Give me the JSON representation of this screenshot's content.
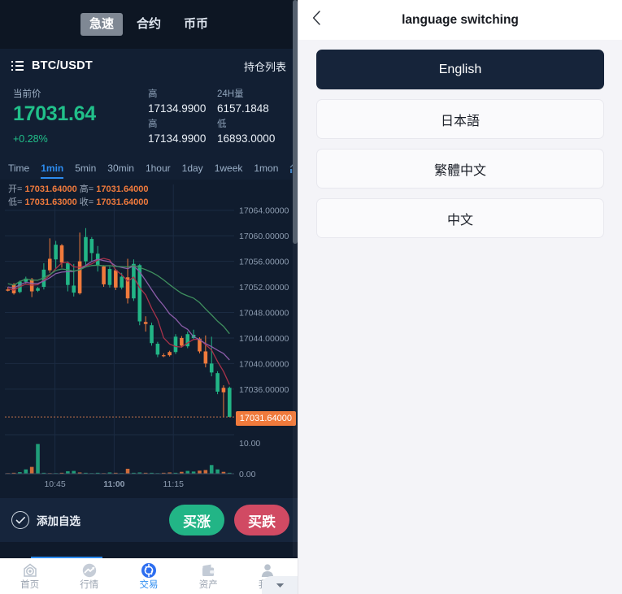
{
  "left": {
    "top_tabs": [
      {
        "label": "急速",
        "active": true
      },
      {
        "label": "合约",
        "active": false
      },
      {
        "label": "币币",
        "active": false
      }
    ],
    "pair": {
      "icon": "list-icon",
      "name": "BTC/USDT",
      "positions_label": "持仓列表"
    },
    "quote": {
      "current_label": "当前价",
      "current_price": "17031.64",
      "change_percent": "+0.28%",
      "cells": [
        {
          "label": "高",
          "value": "17134.9900"
        },
        {
          "label": "24H量",
          "value": "6157.1848"
        },
        {
          "label": "高",
          "value": "17134.9900"
        },
        {
          "label": "低",
          "value": "16893.0000"
        }
      ]
    },
    "intervals": [
      {
        "label": "Time",
        "active": false
      },
      {
        "label": "1min",
        "active": true
      },
      {
        "label": "5min",
        "active": false
      },
      {
        "label": "30min",
        "active": false
      },
      {
        "label": "1hour",
        "active": false
      },
      {
        "label": "1day",
        "active": false
      },
      {
        "label": "1week",
        "active": false
      },
      {
        "label": "1mon",
        "active": false
      }
    ],
    "indicator_icon": "bar-chart-icon",
    "ohlc": {
      "open_label": "开=",
      "open_value": "17031.64000",
      "high_label": "高=",
      "high_value": "17031.64000",
      "low_label": "低=",
      "low_value": "17031.63000",
      "close_label": "收=",
      "close_value": "17031.64000"
    },
    "price_tag": "17031.64000",
    "action": {
      "fav_label": "添加自选",
      "fav_icon": "check-circle-icon",
      "buy_up": "买涨",
      "buy_down": "买跌"
    },
    "bottom_nav": [
      {
        "label": "首页",
        "icon": "home-target-icon",
        "active": false
      },
      {
        "label": "行情",
        "icon": "trend-arrow-icon",
        "active": false
      },
      {
        "label": "交易",
        "icon": "exchange-circle-icon",
        "active": true
      },
      {
        "label": "资产",
        "icon": "wallet-icon",
        "active": false
      },
      {
        "label": "我的",
        "icon": "person-icon",
        "active": false
      }
    ],
    "collapse_icon": "chevron-down-icon",
    "colors": {
      "up": "#22b586",
      "down": "#f07a3c",
      "accent": "#2d8cf0",
      "price": "#21c08a",
      "sell": "#d14a63",
      "panel_bg": "#0f1a2b"
    }
  },
  "right": {
    "back_icon": "chevron-left-icon",
    "title": "language switching",
    "languages": [
      {
        "label": "English",
        "selected": true
      },
      {
        "label": "日本語",
        "selected": false
      },
      {
        "label": "繁體中文",
        "selected": false
      },
      {
        "label": "中文",
        "selected": false
      }
    ]
  },
  "chart_data": {
    "type": "candlestick",
    "title": "BTC/USDT 1min",
    "xlabel": "",
    "ylabel": "",
    "ylim": [
      17030.0,
      17066.0
    ],
    "y_ticks": [
      "17064.00000",
      "17060.00000",
      "17056.00000",
      "17052.00000",
      "17048.00000",
      "17044.00000",
      "17040.00000",
      "17036.00000"
    ],
    "y_tick_values": [
      17064,
      17060,
      17056,
      17052,
      17048,
      17044,
      17040,
      17036
    ],
    "x_ticks": [
      "10:45",
      "11:00",
      "11:15"
    ],
    "last_price_line": 17031.64,
    "up_color": "#22b586",
    "down_color": "#f07a3c",
    "ma_lines": [
      {
        "name": "MA green",
        "color": "#3f8f5e"
      },
      {
        "name": "MA red",
        "color": "#a8324a"
      },
      {
        "name": "MA purple",
        "color": "#8a5ca8"
      }
    ],
    "candles": [
      {
        "o": 17051.6,
        "h": 17052.0,
        "l": 17051.3,
        "c": 17051.4,
        "dir": "down"
      },
      {
        "o": 17052.4,
        "h": 17052.6,
        "l": 17050.8,
        "c": 17051.0,
        "dir": "down"
      },
      {
        "o": 17051.2,
        "h": 17053.0,
        "l": 17051.0,
        "c": 17052.8,
        "dir": "up"
      },
      {
        "o": 17052.8,
        "h": 17053.6,
        "l": 17052.5,
        "c": 17053.3,
        "dir": "up"
      },
      {
        "o": 17053.2,
        "h": 17053.4,
        "l": 17050.4,
        "c": 17051.3,
        "dir": "down"
      },
      {
        "o": 17051.4,
        "h": 17052.0,
        "l": 17051.2,
        "c": 17051.8,
        "dir": "up"
      },
      {
        "o": 17052.0,
        "h": 17055.7,
        "l": 17051.6,
        "c": 17054.7,
        "dir": "up"
      },
      {
        "o": 17054.6,
        "h": 17059.6,
        "l": 17054.2,
        "c": 17056.4,
        "dir": "down"
      },
      {
        "o": 17056.3,
        "h": 17059.2,
        "l": 17054.9,
        "c": 17058.6,
        "dir": "up"
      },
      {
        "o": 17058.5,
        "h": 17058.7,
        "l": 17055.0,
        "c": 17055.8,
        "dir": "down"
      },
      {
        "o": 17055.7,
        "h": 17056.0,
        "l": 17051.3,
        "c": 17052.3,
        "dir": "up"
      },
      {
        "o": 17052.2,
        "h": 17055.6,
        "l": 17050.5,
        "c": 17051.1,
        "dir": "up"
      },
      {
        "o": 17051.0,
        "h": 17060.5,
        "l": 17050.8,
        "c": 17056.0,
        "dir": "down"
      },
      {
        "o": 17056.0,
        "h": 17061.2,
        "l": 17055.4,
        "c": 17059.8,
        "dir": "up"
      },
      {
        "o": 17059.5,
        "h": 17059.8,
        "l": 17056.0,
        "c": 17057.3,
        "dir": "up"
      },
      {
        "o": 17057.2,
        "h": 17058.4,
        "l": 17054.4,
        "c": 17055.3,
        "dir": "up"
      },
      {
        "o": 17055.2,
        "h": 17055.4,
        "l": 17052.0,
        "c": 17052.4,
        "dir": "down"
      },
      {
        "o": 17052.3,
        "h": 17055.2,
        "l": 17051.9,
        "c": 17054.8,
        "dir": "up"
      },
      {
        "o": 17054.6,
        "h": 17054.8,
        "l": 17051.5,
        "c": 17051.9,
        "dir": "down"
      },
      {
        "o": 17051.9,
        "h": 17054.2,
        "l": 17051.6,
        "c": 17053.6,
        "dir": "up"
      },
      {
        "o": 17053.5,
        "h": 17056.4,
        "l": 17049.4,
        "c": 17050.2,
        "dir": "down"
      },
      {
        "o": 17050.2,
        "h": 17056.3,
        "l": 17049.8,
        "c": 17055.6,
        "dir": "up"
      },
      {
        "o": 17055.4,
        "h": 17055.6,
        "l": 17046.0,
        "c": 17046.6,
        "dir": "up"
      },
      {
        "o": 17046.5,
        "h": 17047.4,
        "l": 17045.0,
        "c": 17046.2,
        "dir": "down"
      },
      {
        "o": 17046.0,
        "h": 17046.4,
        "l": 17042.8,
        "c": 17043.2,
        "dir": "up"
      },
      {
        "o": 17043.1,
        "h": 17043.4,
        "l": 17041.0,
        "c": 17041.4,
        "dir": "up"
      },
      {
        "o": 17041.3,
        "h": 17041.6,
        "l": 17041.0,
        "c": 17041.2,
        "dir": "down"
      },
      {
        "o": 17041.3,
        "h": 17042.0,
        "l": 17041.1,
        "c": 17041.8,
        "dir": "down"
      },
      {
        "o": 17041.8,
        "h": 17044.6,
        "l": 17041.5,
        "c": 17044.2,
        "dir": "up"
      },
      {
        "o": 17044.0,
        "h": 17044.3,
        "l": 17042.5,
        "c": 17042.8,
        "dir": "down"
      },
      {
        "o": 17042.7,
        "h": 17045.0,
        "l": 17042.4,
        "c": 17044.6,
        "dir": "up"
      },
      {
        "o": 17044.5,
        "h": 17045.3,
        "l": 17043.7,
        "c": 17044.0,
        "dir": "up"
      },
      {
        "o": 17043.9,
        "h": 17044.1,
        "l": 17041.6,
        "c": 17041.9,
        "dir": "down"
      },
      {
        "o": 17041.9,
        "h": 17044.4,
        "l": 17039.4,
        "c": 17040.0,
        "dir": "down"
      },
      {
        "o": 17040.0,
        "h": 17044.2,
        "l": 17038.0,
        "c": 17038.6,
        "dir": "up"
      },
      {
        "o": 17038.5,
        "h": 17038.8,
        "l": 17035.2,
        "c": 17035.6,
        "dir": "up"
      },
      {
        "o": 17035.5,
        "h": 17036.6,
        "l": 17031.6,
        "c": 17036.2,
        "dir": "down"
      },
      {
        "o": 17036.2,
        "h": 17036.4,
        "l": 17031.6,
        "c": 17031.64,
        "dir": "up"
      }
    ],
    "volume": {
      "y_ticks": [
        "10.00",
        "0.00"
      ],
      "y_tick_values": [
        10,
        0
      ],
      "values": [
        0.2,
        0.3,
        0.5,
        1.4,
        2.2,
        9.6,
        0.3,
        0.2,
        0.2,
        0.3,
        0.8,
        0.9,
        0.4,
        0.3,
        0.2,
        0.3,
        0.2,
        0.4,
        0.3,
        0.2,
        1.6,
        0.3,
        0.4,
        0.3,
        0.3,
        0.2,
        0.3,
        0.4,
        0.3,
        0.6,
        0.9,
        0.7,
        1.0,
        1.2,
        2.8,
        1.4,
        0.6,
        0.3
      ]
    }
  }
}
